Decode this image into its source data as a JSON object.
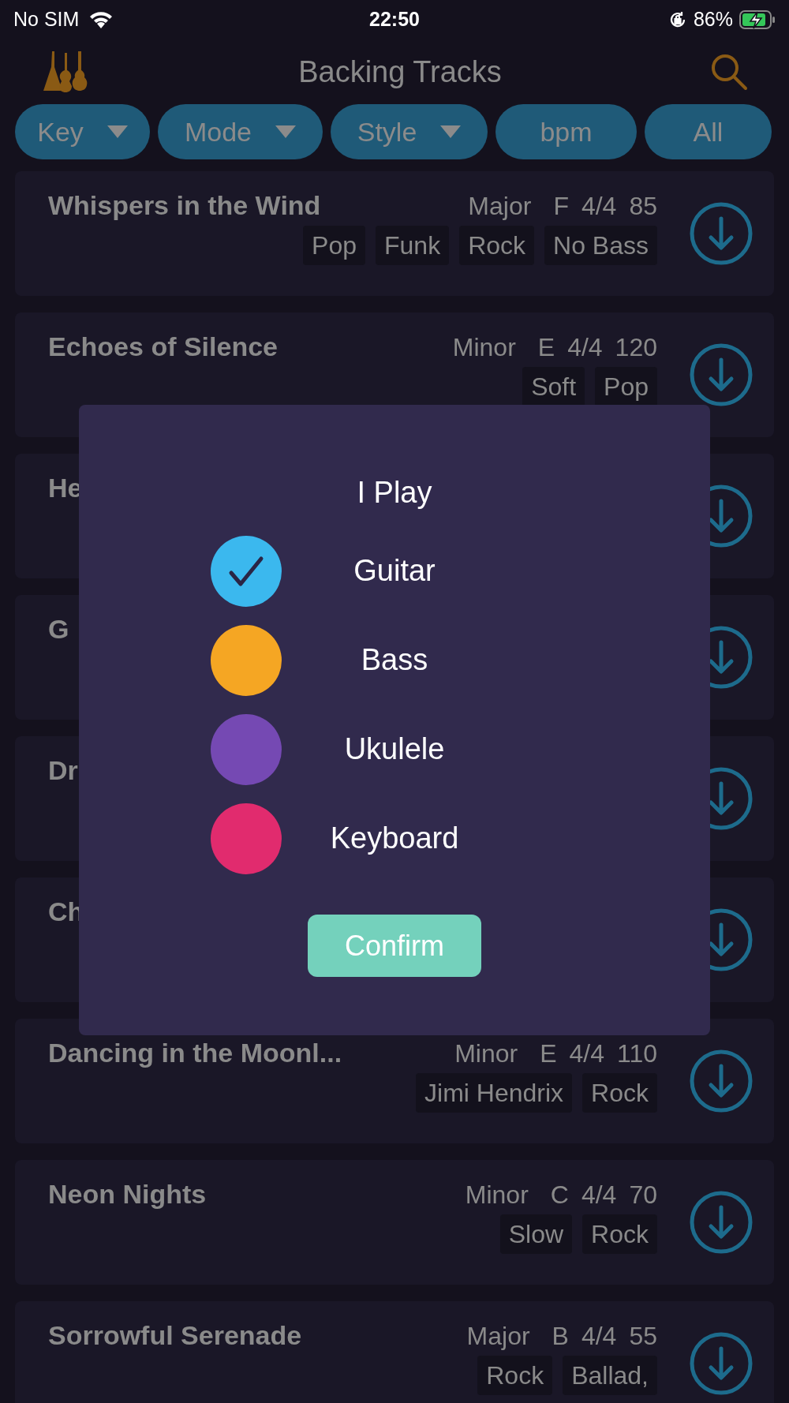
{
  "status_bar": {
    "carrier": "No SIM",
    "time": "22:50",
    "battery": "86%",
    "charging": true
  },
  "header": {
    "title": "Backing Tracks"
  },
  "filters": [
    {
      "label": "Key",
      "dropdown": true
    },
    {
      "label": "Mode",
      "dropdown": true
    },
    {
      "label": "Style",
      "dropdown": true
    },
    {
      "label": "bpm",
      "dropdown": false
    },
    {
      "label": "All",
      "dropdown": false
    }
  ],
  "tracks": [
    {
      "title": "Whispers in the Wind",
      "mode": "Major",
      "key": "F",
      "meter": "4/4",
      "bpm": "85",
      "tags": [
        "Pop",
        "Funk",
        "Rock",
        "No Bass"
      ]
    },
    {
      "title": "Echoes of Silence",
      "mode": "Minor",
      "key": "E",
      "meter": "4/4",
      "bpm": "120",
      "tags": [
        "Soft",
        "Pop"
      ]
    },
    {
      "title": "He"
    },
    {
      "title": "G"
    },
    {
      "title": "Dr"
    },
    {
      "title": "Ch"
    },
    {
      "title": "Dancing in the Moonl...",
      "mode": "Minor",
      "key": "E",
      "meter": "4/4",
      "bpm": "110",
      "tags": [
        "Jimi Hendrix",
        "Rock"
      ]
    },
    {
      "title": "Neon Nights",
      "mode": "Minor",
      "key": "C",
      "meter": "4/4",
      "bpm": "70",
      "tags": [
        "Slow",
        "Rock"
      ]
    },
    {
      "title": "Sorrowful Serenade",
      "mode": "Major",
      "key": "B",
      "meter": "4/4",
      "bpm": "55",
      "tags": [
        "Rock",
        "Ballad,"
      ]
    }
  ],
  "dialog": {
    "title": "I Play",
    "options": [
      {
        "label": "Guitar",
        "checked": true,
        "color": "#3bb8ee"
      },
      {
        "label": "Bass",
        "checked": false,
        "color": "#f5a623"
      },
      {
        "label": "Ukulele",
        "checked": false,
        "color": "#7549b3"
      },
      {
        "label": "Keyboard",
        "checked": false,
        "color": "#e12b6e"
      }
    ],
    "confirm": "Confirm"
  }
}
